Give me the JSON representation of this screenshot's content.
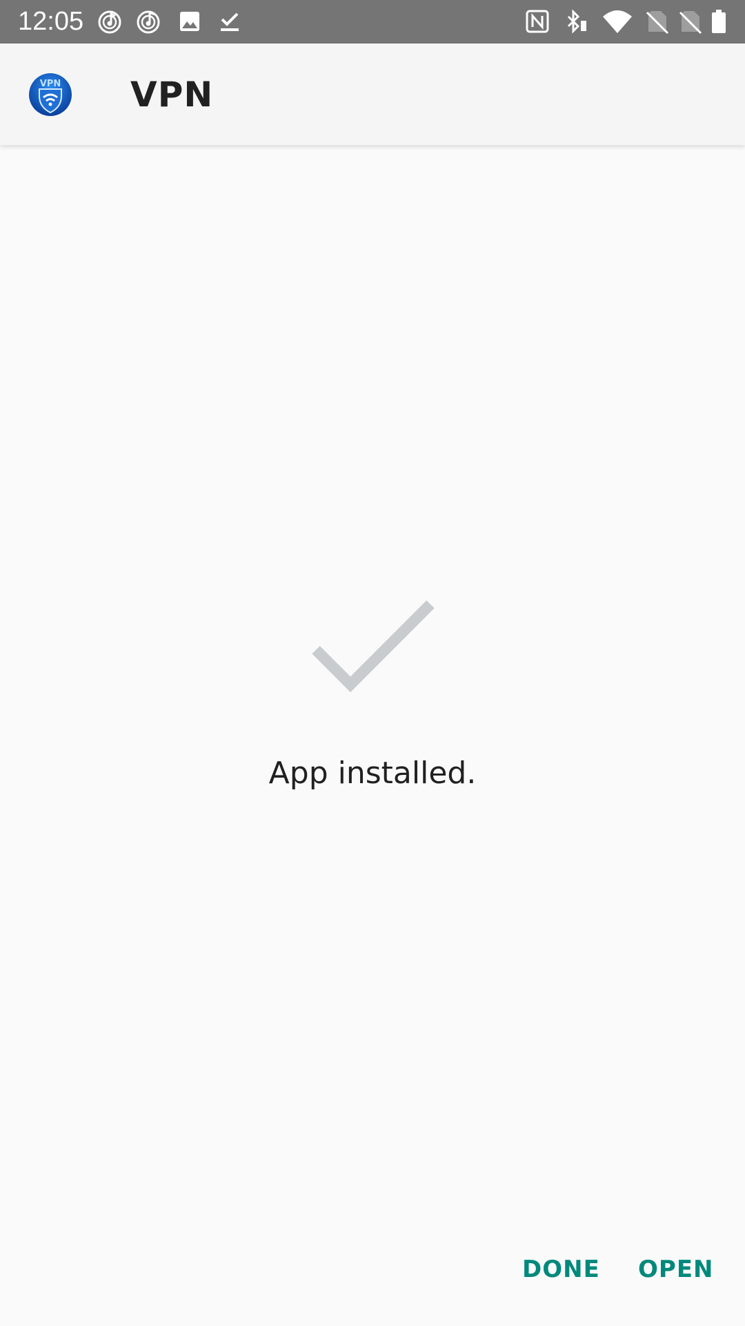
{
  "status_bar": {
    "time": "12:05",
    "left_icons": [
      "music-notification-icon",
      "music-notification-icon",
      "image-notification-icon",
      "download-done-icon"
    ],
    "right_icons": [
      "nfc-icon",
      "bluetooth-icon",
      "wifi-icon",
      "no-sim-icon",
      "no-sim-icon",
      "battery-icon"
    ]
  },
  "app_bar": {
    "icon": "vpn-app-icon",
    "icon_text": "VPN",
    "title": "VPN"
  },
  "content": {
    "status_icon": "checkmark-icon",
    "message": "App installed."
  },
  "actions": {
    "done_label": "DONE",
    "open_label": "OPEN"
  },
  "colors": {
    "status_bar": "#757575",
    "app_bar": "#f5f5f5",
    "background": "#fafafa",
    "accent": "#00897b",
    "checkmark": "#c8ccce"
  }
}
